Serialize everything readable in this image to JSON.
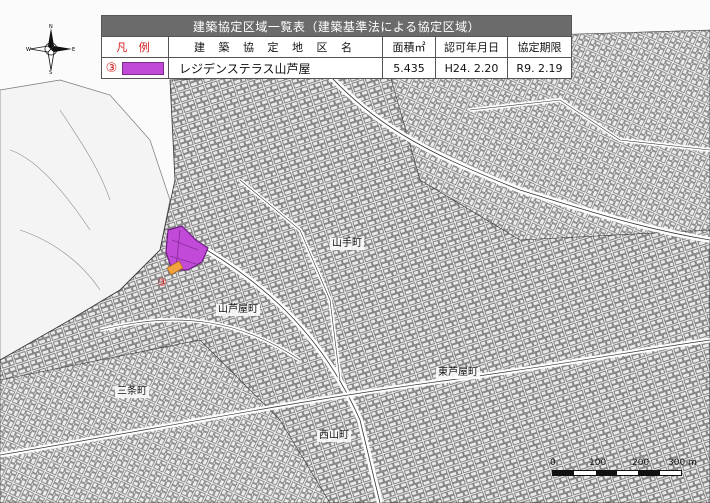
{
  "legend": {
    "title": "建築協定区域一覧表（建築基準法による協定区域）",
    "headers": {
      "legend": "凡 例",
      "district_name": "建 築 協 定 地 区 名",
      "area": "面積㎡",
      "approval_date": "認可年月日",
      "expiry": "協定期限"
    },
    "rows": [
      {
        "number": "③",
        "name": "レジデンステラス山芦屋",
        "area": "5.435",
        "approval_date": "H24. 2.20",
        "expiry": "R9. 2.19",
        "swatch_color": "#c24ad8"
      }
    ]
  },
  "map_labels": {
    "yamate": "山手町",
    "yamaashiya": "山芦屋町",
    "sanjo": "三条町",
    "higashi_ashiya": "東芦屋町",
    "nishiyama": "西山町",
    "marker": "③"
  },
  "compass": {
    "north": "N",
    "south": "S",
    "east": "E",
    "west": "W"
  },
  "scale": {
    "t0": "0",
    "t1": "100",
    "t2": "200",
    "t3": "300 m"
  },
  "colors": {
    "district": "#c24ad8",
    "road": "#ffffff",
    "block_line": "#333333",
    "accent_red": "#d01818"
  }
}
